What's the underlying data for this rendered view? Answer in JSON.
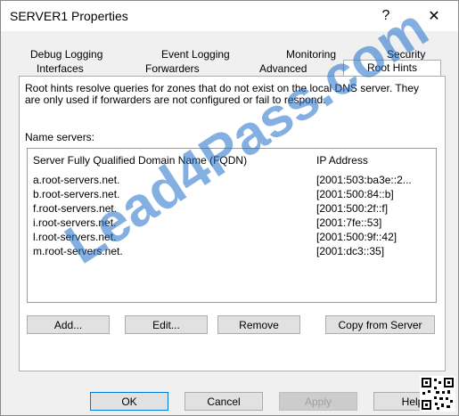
{
  "window": {
    "title": "SERVER1 Properties",
    "help_glyph": "?",
    "close_glyph": "✕"
  },
  "tabs": {
    "row1": [
      "Debug Logging",
      "Event Logging",
      "Monitoring",
      "Security"
    ],
    "row2": [
      "Interfaces",
      "Forwarders",
      "Advanced",
      "Root Hints"
    ],
    "active": "Root Hints"
  },
  "root_hints": {
    "description": "Root hints resolve queries for zones that do not exist on the local DNS server.  They are only used if forwarders are not configured or fail to respond.",
    "name_servers_label": "Name servers:",
    "columns": {
      "fqdn": "Server Fully Qualified Domain Name (FQDN)",
      "ip": "IP Address"
    },
    "servers": [
      {
        "fqdn": "a.root-servers.net.",
        "ip": "[2001:503:ba3e::2..."
      },
      {
        "fqdn": "b.root-servers.net.",
        "ip": "[2001:500:84::b]"
      },
      {
        "fqdn": "f.root-servers.net.",
        "ip": "[2001:500:2f::f]"
      },
      {
        "fqdn": "i.root-servers.net.",
        "ip": "[2001:7fe::53]"
      },
      {
        "fqdn": "l.root-servers.net.",
        "ip": "[2001:500:9f::42]"
      },
      {
        "fqdn": "m.root-servers.net.",
        "ip": "[2001:dc3::35]"
      }
    ],
    "buttons": {
      "add": "Add...",
      "edit": "Edit...",
      "remove": "Remove",
      "copy": "Copy from Server"
    }
  },
  "footer": {
    "ok": "OK",
    "cancel": "Cancel",
    "apply": "Apply",
    "help": "Help"
  },
  "watermark": "Lead4Pass.com"
}
